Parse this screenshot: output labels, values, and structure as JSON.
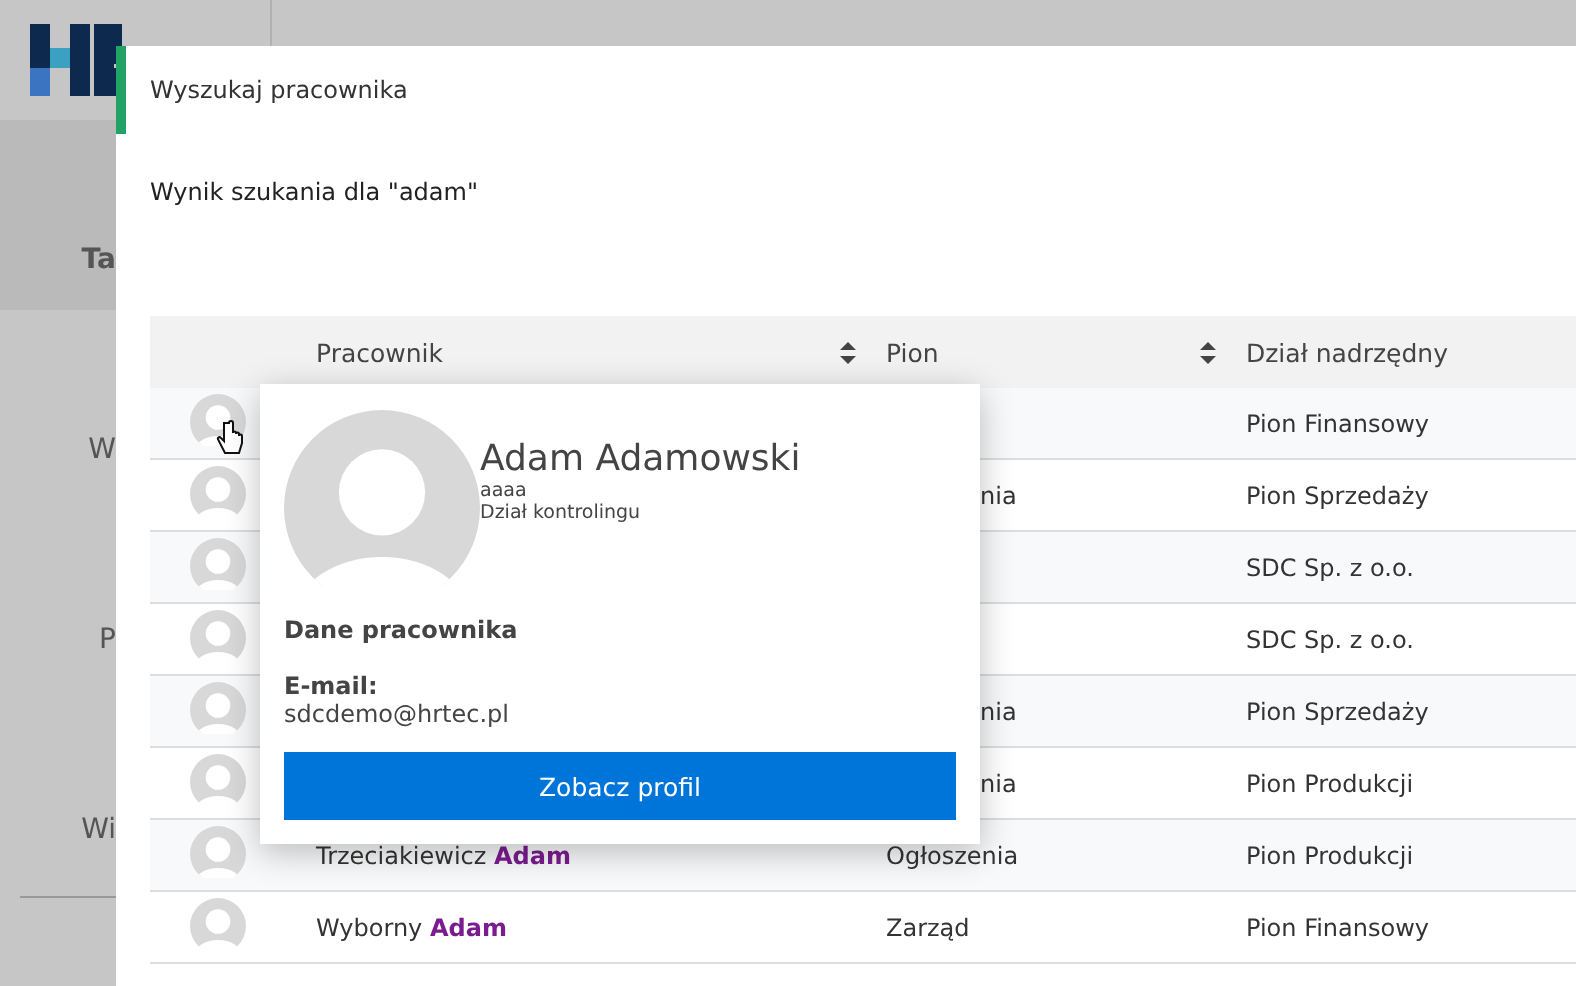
{
  "sidebar": {
    "items": [
      {
        "label": "Ta",
        "selected": true
      },
      {
        "label": "W",
        "selected": false
      },
      {
        "label": "P",
        "selected": false
      },
      {
        "label": "Wi",
        "selected": false
      }
    ]
  },
  "modal": {
    "title": "Wyszukaj pracownika",
    "result_heading": "Wynik szukania dla \"adam\"",
    "table": {
      "columns": [
        {
          "label": "Pracownik",
          "sortable": true
        },
        {
          "label": "Pion",
          "sortable": true
        },
        {
          "label": "Dział nadrzędny",
          "sortable": false
        }
      ],
      "rows": [
        {
          "parent": "Pion Finansowy"
        },
        {
          "pion": "nia",
          "parent": "Pion Sprzedaży"
        },
        {
          "parent": "SDC Sp. z o.o."
        },
        {
          "parent": "SDC Sp. z o.o."
        },
        {
          "pion": "nia",
          "parent": "Pion Sprzedaży"
        },
        {
          "pion": "nia",
          "parent": "Pion Produkcji"
        },
        {
          "name": "Trzeciakiewicz **Adam**",
          "pion": "Ogłoszenia",
          "parent": "Pion Produkcji"
        },
        {
          "name": "Wyborny **Adam**",
          "pion": "Zarząd",
          "parent": "Pion Finansowy"
        }
      ]
    },
    "popup": {
      "name": "Adam Adamowski",
      "position": "aaaa",
      "department": "Dział kontrolingu",
      "section": "Dane pracownika",
      "email_label": "E-mail:",
      "email": "sdcdemo@hrtec.pl",
      "button": "Zobacz profil"
    }
  }
}
